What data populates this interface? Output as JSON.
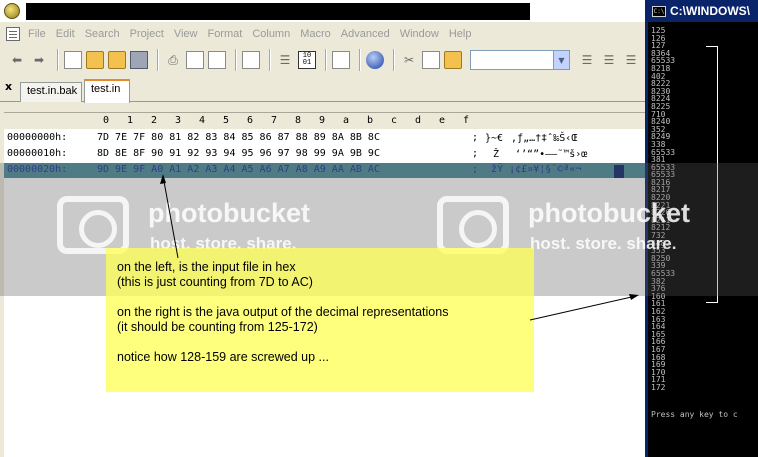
{
  "editor": {
    "menu": [
      "File",
      "Edit",
      "Search",
      "Project",
      "View",
      "Format",
      "Column",
      "Macro",
      "Advanced",
      "Window",
      "Help"
    ],
    "tabs": [
      "test.in.bak",
      "test.in"
    ],
    "close_glyph": "x",
    "hex_ruler": [
      "0",
      "1",
      "2",
      "3",
      "4",
      "5",
      "6",
      "7",
      "8",
      "9",
      "a",
      "b",
      "c",
      "d",
      "e",
      "f"
    ],
    "hex_rows": [
      {
        "address": "00000000h:",
        "bytes": "7D 7E 7F 80 81 82 83 84 85 86 87 88 89 8A 8B 8C",
        "sep": ";",
        "chars": "}~€‚ƒ„…†‡ˆ‰Š‹Œ"
      },
      {
        "address": "00000010h:",
        "bytes": "8D 8E 8F 90 91 92 93 94 95 96 97 98 99 9A 9B 9C",
        "sep": ";",
        "chars": "Ž‘’“”•–—˜™š›œ"
      },
      {
        "address": "00000020h:",
        "bytes": "9D 9E 9F A0 A1 A2 A3 A4 A5 A6 A7 A8 A9 AA AB AC",
        "sep": ";",
        "chars": "žŸ ¡¢£¤¥¦§¨©ª«¬"
      }
    ]
  },
  "console": {
    "title": "C:\\WINDOWS\\",
    "icon_label": "C:\\",
    "output": [
      "125",
      "126",
      "127",
      "8364",
      "65533",
      "8218",
      "402",
      "8222",
      "8230",
      "8224",
      "8225",
      "710",
      "8240",
      "352",
      "8249",
      "338",
      "65533",
      "381",
      "65533",
      "65533",
      "8216",
      "8217",
      "8220",
      "8221",
      "8226",
      "8211",
      "8212",
      "732",
      "8482",
      "353",
      "8250",
      "339",
      "65533",
      "382",
      "376",
      "160",
      "161",
      "162",
      "163",
      "164",
      "165",
      "166",
      "167",
      "168",
      "169",
      "170",
      "171",
      "172"
    ],
    "prompt": "Press any key to c"
  },
  "watermark": {
    "brand": "photobucket",
    "tagline": "host. store. share."
  },
  "annotation": {
    "lines": [
      "on the left, is the input file in hex",
      "(this is just counting from 7D to AC)",
      "on the right is the java output of the decimal representations",
      "(it should be counting from 125-172)",
      "notice how 128-159 are screwed up ..."
    ]
  },
  "colors": {
    "selection_row": "#4a8d98",
    "note_bg": "#ffff5a",
    "console_bg": "#000000",
    "titlebar_blue": "#0a246a"
  }
}
